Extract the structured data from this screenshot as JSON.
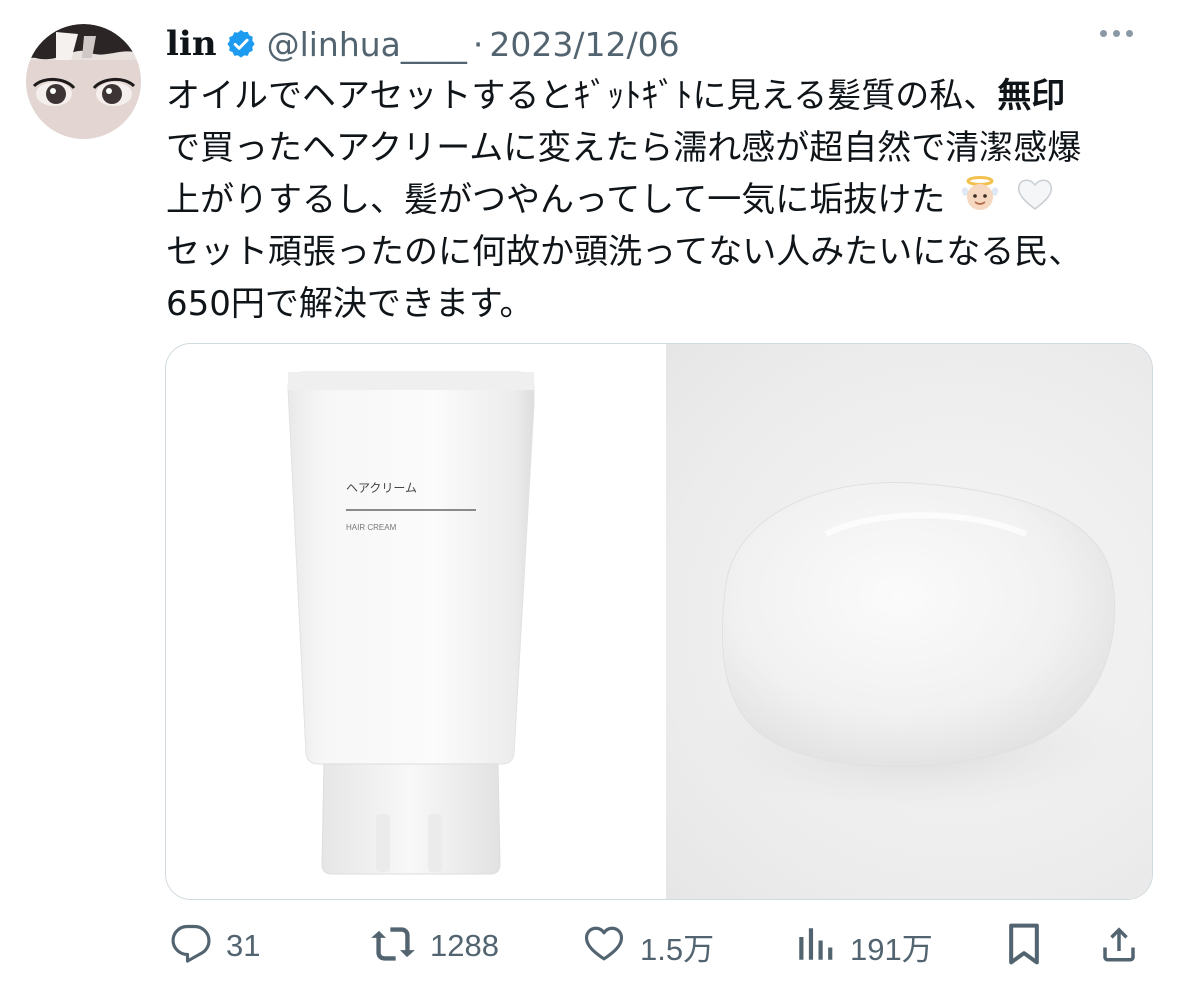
{
  "tweet": {
    "display_name": "lin",
    "handle": "@linhua____",
    "separator": "·",
    "date": "2023/12/06",
    "text_lines": [
      {
        "before": "オイルでヘアセットするとｷﾞｯﾄｷﾞﾄに見える髪質の私、",
        "bold": "無印"
      },
      {
        "plain": "で買ったヘアクリームに変えたら濡れ感が超自然で清潔感爆"
      },
      {
        "plain": "上がりするし、髪がつやんってして一気に垢抜けた"
      },
      {
        "plain": "セット頑張ったのに何故か頭洗ってない人みたいになる民、"
      },
      {
        "plain": "650円で解決できます。"
      }
    ],
    "emojis": [
      "angel-baby-emoji",
      "white-heart-emoji"
    ]
  },
  "media": {
    "left": {
      "product_label_jp": "ヘアクリーム",
      "product_label_en": "HAIR CREAM"
    },
    "right": {
      "icon": "cream-dollop-image"
    }
  },
  "actions": {
    "reply": {
      "icon": "reply-icon",
      "count": "31"
    },
    "retweet": {
      "icon": "retweet-icon",
      "count": "1288"
    },
    "like": {
      "icon": "heart-icon",
      "count": "1.5万"
    },
    "views": {
      "icon": "views-icon",
      "count": "191万"
    },
    "bookmark": {
      "icon": "bookmark-icon"
    },
    "share": {
      "icon": "share-icon"
    }
  },
  "colors": {
    "text_primary": "#0f1419",
    "text_secondary": "#536471",
    "verified_blue": "#1d9bf0",
    "border": "#cfd9de"
  }
}
